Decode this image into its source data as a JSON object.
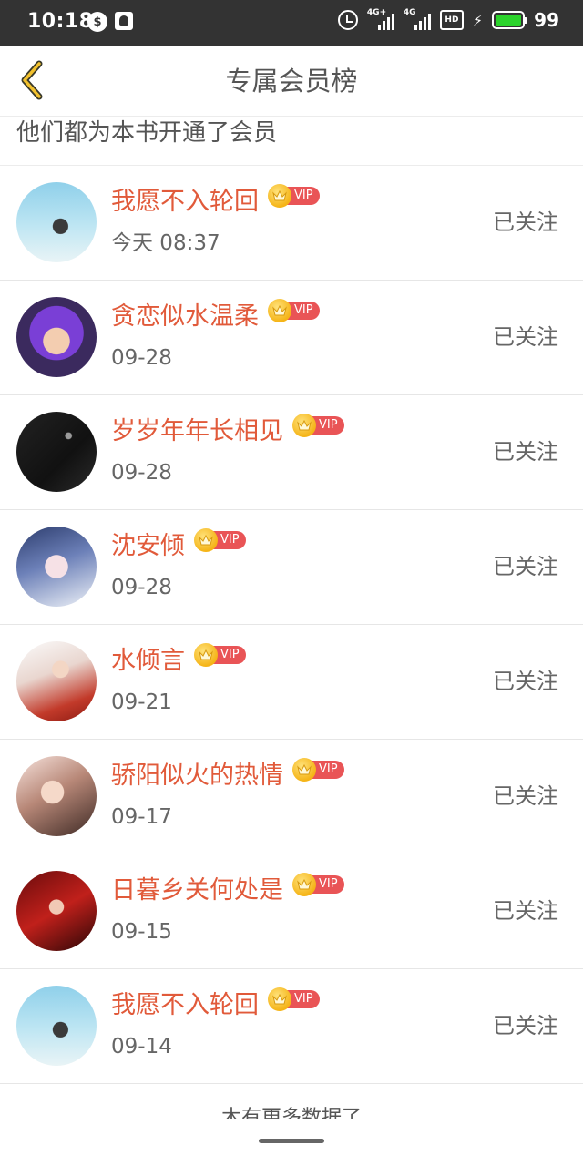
{
  "status_bar": {
    "time": "10:18",
    "signal1_tag": "4G+",
    "signal2_tag": "4G",
    "hd_label": "HD",
    "battery_level": 99,
    "battery_text": "99",
    "battery_color": "#2bd32b"
  },
  "header": {
    "title": "专属会员榜",
    "back_icon": "chevron-left-icon"
  },
  "subtitle": "他们都为本书开通了会员",
  "accent_color": "#e15a3a",
  "vip_color": "#e95456",
  "members": [
    {
      "name": "我愿不入轮回",
      "vip_label": "VIP",
      "time": "今天 08:37",
      "follow_label": "已关注"
    },
    {
      "name": "贪恋似水温柔",
      "vip_label": "VIP",
      "time": "09-28",
      "follow_label": "已关注"
    },
    {
      "name": "岁岁年年长相见",
      "vip_label": "VIP",
      "time": "09-28",
      "follow_label": "已关注"
    },
    {
      "name": "沈安倾",
      "vip_label": "VIP",
      "time": "09-28",
      "follow_label": "已关注"
    },
    {
      "name": "水倾言",
      "vip_label": "VIP",
      "time": "09-21",
      "follow_label": "已关注"
    },
    {
      "name": "骄阳似火的热情",
      "vip_label": "VIP",
      "time": "09-17",
      "follow_label": "已关注"
    },
    {
      "name": "日暮乡关何处是",
      "vip_label": "VIP",
      "time": "09-15",
      "follow_label": "已关注"
    },
    {
      "name": "我愿不入轮回",
      "vip_label": "VIP",
      "time": "09-14",
      "follow_label": "已关注"
    }
  ],
  "footer": {
    "load_more": "木有更多数据了"
  }
}
